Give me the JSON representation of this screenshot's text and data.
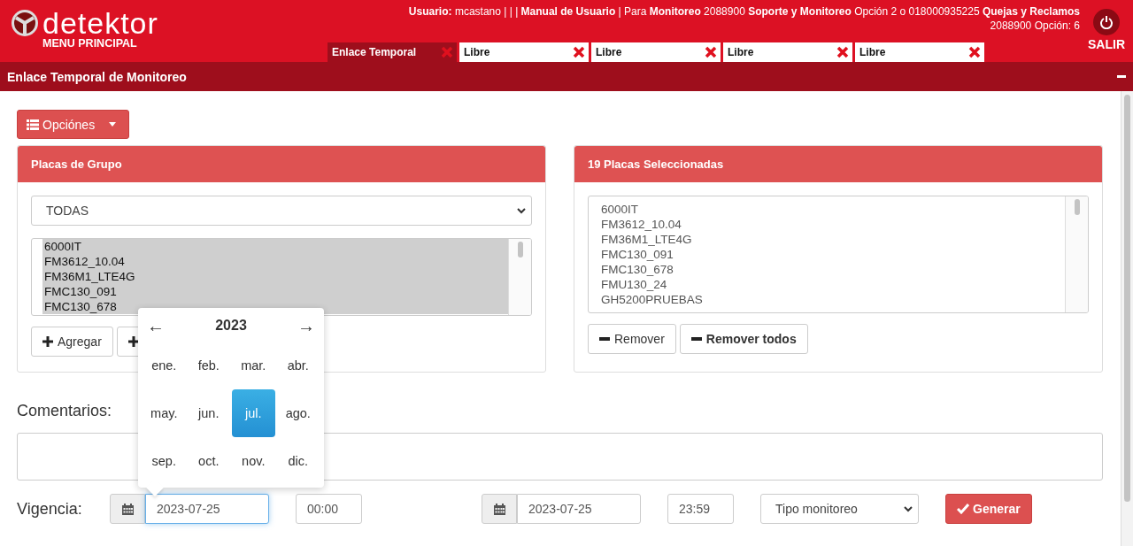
{
  "header": {
    "logo_text": "detektor",
    "menu_label": "MENU PRINCIPAL",
    "info_lines": [
      "**Usuario:** mcastano | | | **Manual de Usuario** | Para **Monitoreo** 2088900 **Soporte y Monitoreo** Opción 2 o 018000935225 **Quejas y Reclamos**",
      "2088900 Opción: 6"
    ],
    "logout_label": "SALIR"
  },
  "tabs": [
    {
      "label": "Enlace Temporal",
      "selected": true
    },
    {
      "label": "Libre",
      "selected": false
    },
    {
      "label": "Libre",
      "selected": false
    },
    {
      "label": "Libre",
      "selected": false
    },
    {
      "label": "Libre",
      "selected": false
    }
  ],
  "page_title": "Enlace Temporal de Monitoreo",
  "options_button": "Opciónes",
  "group_panel": {
    "title": "Placas de Grupo",
    "group_select": "TODAS",
    "items": [
      {
        "label": "6000IT",
        "selected": true
      },
      {
        "label": "FM3612_10.04",
        "selected": true
      },
      {
        "label": "FM36M1_LTE4G",
        "selected": true
      },
      {
        "label": "FMC130_091",
        "selected": true
      },
      {
        "label": "FMC130_678",
        "selected": true
      }
    ],
    "buttons": [
      {
        "label": "Agregar",
        "kind": "add"
      },
      {
        "kind": "add"
      }
    ]
  },
  "selected_panel": {
    "title": "19 Placas Seleccionadas",
    "items": [
      {
        "label": "6000IT",
        "selected": false
      },
      {
        "label": "FM3612_10.04",
        "selected": false
      },
      {
        "label": "FM36M1_LTE4G",
        "selected": false
      },
      {
        "label": "FMC130_091",
        "selected": false
      },
      {
        "label": "FMC130_678",
        "selected": false
      },
      {
        "label": "FMU130_24",
        "selected": false
      },
      {
        "label": "GH5200PRUEBAS",
        "selected": false
      }
    ],
    "buttons": [
      {
        "label": "Remover",
        "kind": "remove"
      },
      {
        "label": "Remover todos",
        "kind": "remove_all"
      }
    ]
  },
  "comments_label": "Comentarios:",
  "validity": {
    "label": "Vigencia:",
    "start_date": "2023-07-25",
    "start_time": "00:00",
    "end_date": "2023-07-25",
    "end_time": "23:59",
    "monitor_type": "Tipo monitoreo",
    "generate_button": "Generar"
  },
  "month_picker": {
    "prev": "←",
    "year": "2023",
    "next": "→",
    "months": [
      {
        "label": "ene.",
        "selected": false
      },
      {
        "label": "feb.",
        "selected": false
      },
      {
        "label": "mar.",
        "selected": false
      },
      {
        "label": "abr.",
        "selected": false
      },
      {
        "label": "may.",
        "selected": false
      },
      {
        "label": "jun.",
        "selected": false
      },
      {
        "label": "jul.",
        "selected": true
      },
      {
        "label": "ago.",
        "selected": false
      },
      {
        "label": "sep.",
        "selected": false
      },
      {
        "label": "oct.",
        "selected": false
      },
      {
        "label": "nov.",
        "selected": false
      },
      {
        "label": "dic.",
        "selected": false
      }
    ]
  }
}
